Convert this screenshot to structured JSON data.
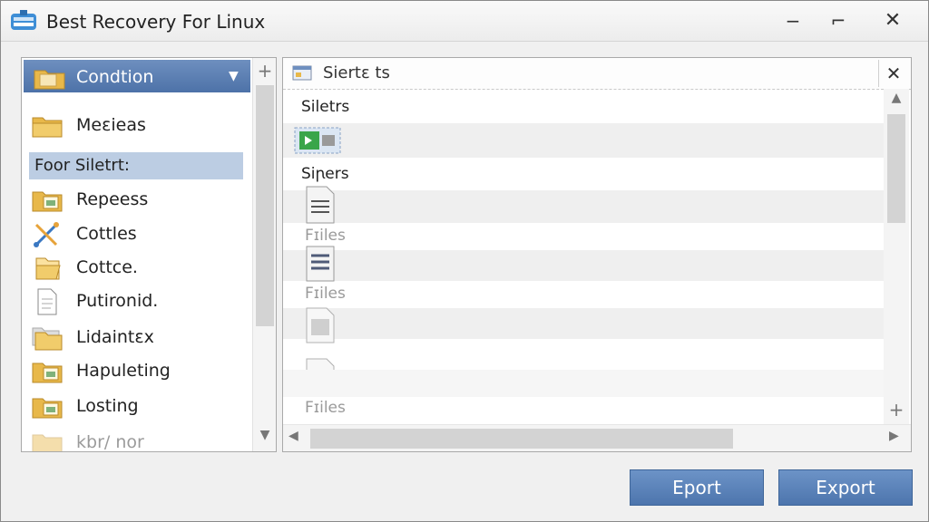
{
  "window": {
    "title": "Best Recovery For Linux",
    "controls": {
      "minimize": "−",
      "maximize": "⌐",
      "close": "✕"
    }
  },
  "left_panel": {
    "header_label": "Condtion",
    "items": [
      {
        "label": "Meɛieas",
        "icon": "folder-icon"
      },
      {
        "label": "Repeess",
        "icon": "folder-image-icon"
      },
      {
        "label": "Cottles",
        "icon": "tools-icon"
      },
      {
        "label": "Cottce.",
        "icon": "folder-open-icon"
      },
      {
        "label": "Putironid.",
        "icon": "document-icon"
      },
      {
        "label": "Lidaintɛx",
        "icon": "folder-stack-icon"
      },
      {
        "label": "Hapuleting",
        "icon": "folder-image-icon"
      },
      {
        "label": "Losting",
        "icon": "folder-image-icon"
      },
      {
        "label": "kbr/ nor",
        "icon": "folder-image-icon"
      }
    ],
    "section_label": "Foor Siletrt:"
  },
  "right_panel": {
    "header_label": "Siertɛ ts",
    "labels": {
      "siletrs": "Siletrs",
      "sifters": "Siꞃers",
      "files_1": "Fɪiles",
      "files_2": "Fɪiles",
      "files_3": "Fɪiles"
    }
  },
  "buttons": {
    "eport": "Eport",
    "export": "Export"
  },
  "colors": {
    "accent": "#4d72a8",
    "selection": "#bccde3",
    "button": "#5a82b9"
  }
}
